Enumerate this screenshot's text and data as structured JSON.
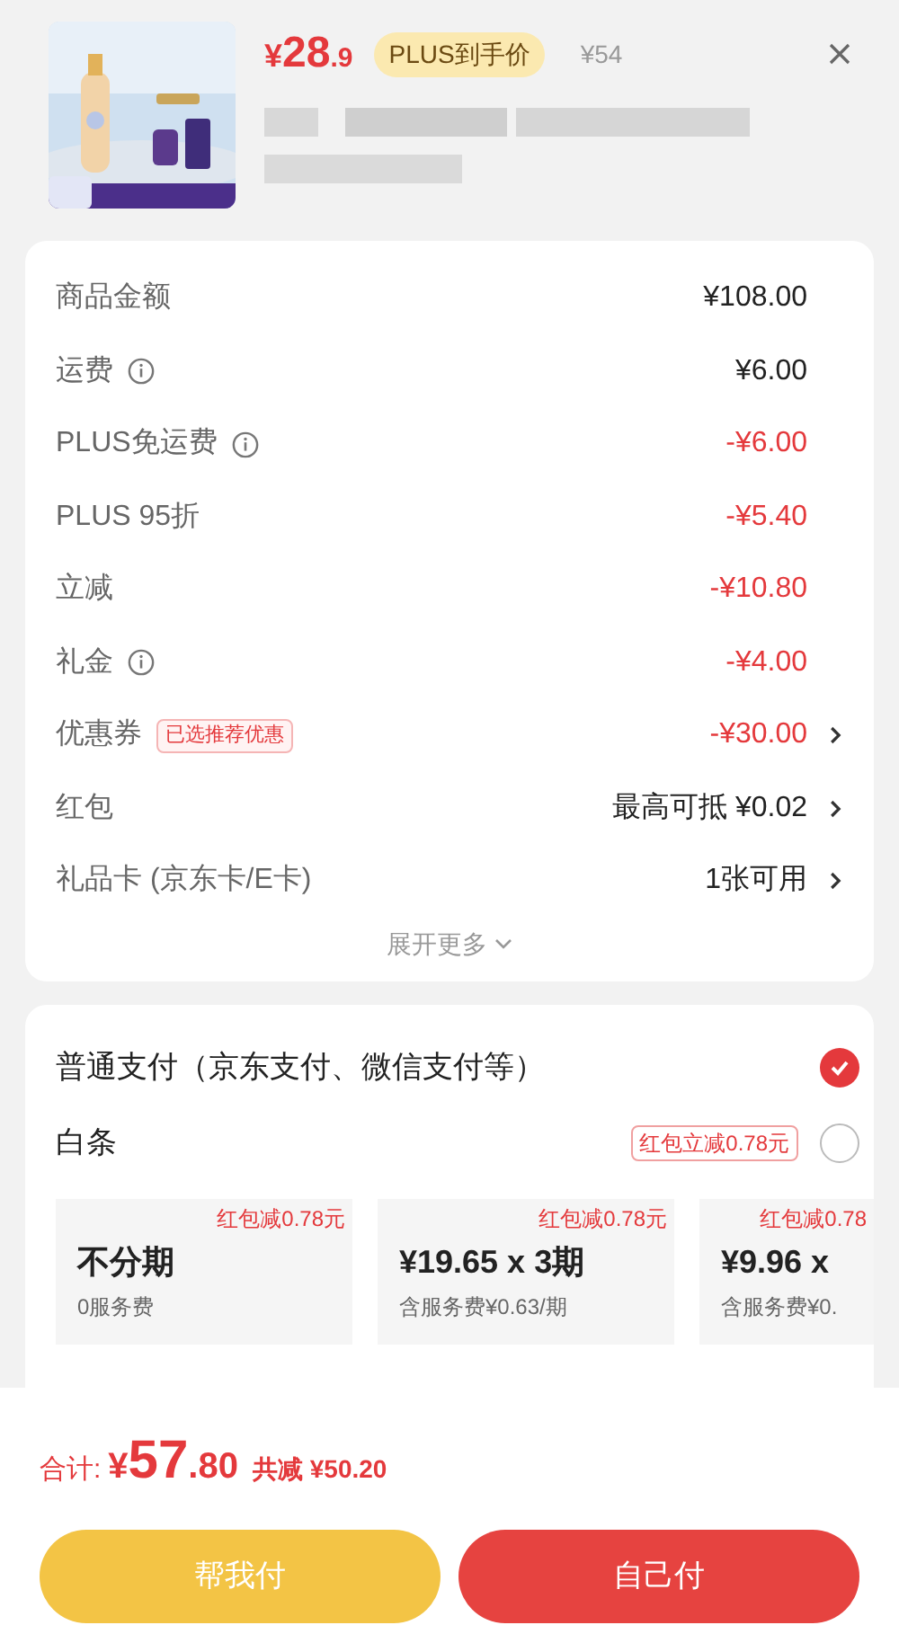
{
  "product": {
    "price_symbol": "¥",
    "price_int": "28",
    "price_dec": ".9",
    "badge": "PLUS到手价",
    "original_price": "¥54"
  },
  "details": [
    {
      "label": "商品金额",
      "info": false,
      "value": "¥108.00",
      "kind": "normal",
      "arrow": false
    },
    {
      "label": "运费",
      "info": true,
      "value": "¥6.00",
      "kind": "normal",
      "arrow": false
    },
    {
      "label": "PLUS免运费",
      "info": true,
      "value": "-¥6.00",
      "kind": "discount",
      "arrow": false
    },
    {
      "label": "PLUS 95折",
      "info": false,
      "value": "-¥5.40",
      "kind": "discount",
      "arrow": false
    },
    {
      "label": "立减",
      "info": false,
      "value": "-¥10.80",
      "kind": "discount",
      "arrow": false
    },
    {
      "label": "礼金",
      "info": true,
      "value": "-¥4.00",
      "kind": "discount",
      "arrow": false
    },
    {
      "label": "优惠券",
      "info": false,
      "tag": "已选推荐优惠",
      "value": "-¥30.00",
      "kind": "discount",
      "arrow": true
    },
    {
      "label": "红包",
      "info": false,
      "value": "最高可抵 ¥0.02",
      "kind": "normal",
      "arrow": true
    },
    {
      "label": "礼品卡 (京东卡/E卡)",
      "info": false,
      "value": "1张可用",
      "kind": "normal",
      "arrow": true
    }
  ],
  "expand": "展开更多",
  "payment": {
    "options": [
      {
        "label": "普通支付（京东支付、微信支付等）",
        "selected": true
      },
      {
        "label": "白条",
        "tag": "红包立减0.78元",
        "selected": false
      }
    ],
    "plans": [
      {
        "badge": "红包减0.78元",
        "title": "不分期",
        "subtitle": "0服务费"
      },
      {
        "badge": "红包减0.78元",
        "title": "¥19.65 x 3期",
        "subtitle": "含服务费¥0.63/期"
      },
      {
        "badge": "红包减0.78",
        "title": "¥9.96 x",
        "subtitle": "含服务费¥0."
      }
    ]
  },
  "total": {
    "label": "合计:",
    "symbol": "¥",
    "int": "57",
    "dec": ".80",
    "saved": "共减 ¥50.20"
  },
  "buttons": [
    {
      "label": "帮我付",
      "kind": "secondary"
    },
    {
      "label": "自己付",
      "kind": "primary"
    }
  ]
}
